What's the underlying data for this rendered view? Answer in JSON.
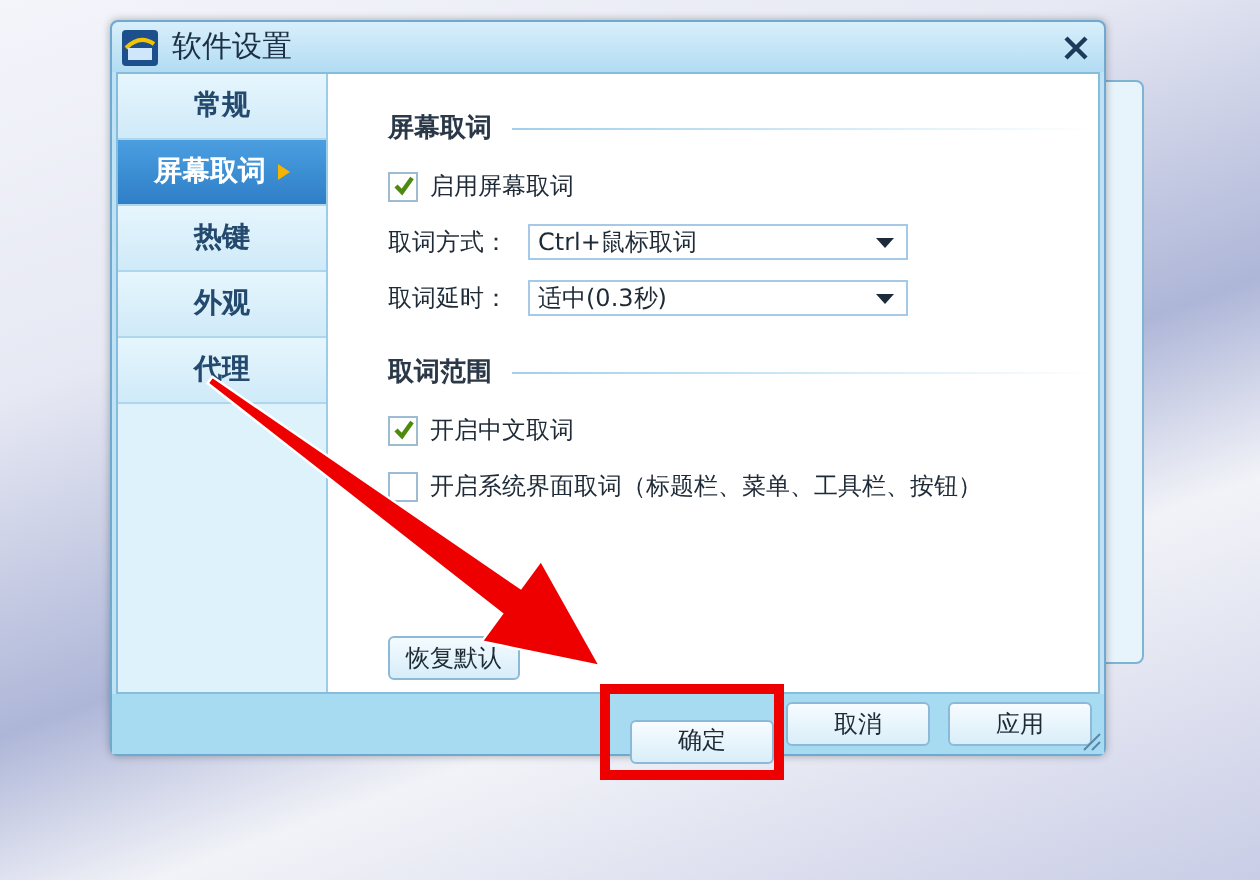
{
  "window": {
    "title": "软件设置"
  },
  "sidebar": {
    "items": [
      {
        "label": "常规",
        "selected": false
      },
      {
        "label": "屏幕取词",
        "selected": true
      },
      {
        "label": "热键",
        "selected": false
      },
      {
        "label": "外观",
        "selected": false
      },
      {
        "label": "代理",
        "selected": false
      }
    ]
  },
  "sections": [
    {
      "title": "屏幕取词",
      "rows": [
        {
          "kind": "checkbox",
          "label": "启用屏幕取词",
          "checked": true
        },
        {
          "kind": "select",
          "label": "取词方式：",
          "value": "Ctrl+鼠标取词"
        },
        {
          "kind": "select",
          "label": "取词延时：",
          "value": "适中(0.3秒)"
        }
      ]
    },
    {
      "title": "取词范围",
      "rows": [
        {
          "kind": "checkbox",
          "label": "开启中文取词",
          "checked": true
        },
        {
          "kind": "checkbox",
          "label": "开启系统界面取词（标题栏、菜单、工具栏、按钮）",
          "checked": false
        }
      ]
    }
  ],
  "reset_button": "恢复默认",
  "buttons": [
    {
      "label": "确定",
      "highlighted": true
    },
    {
      "label": "取消",
      "highlighted": false
    },
    {
      "label": "应用",
      "highlighted": false
    }
  ]
}
